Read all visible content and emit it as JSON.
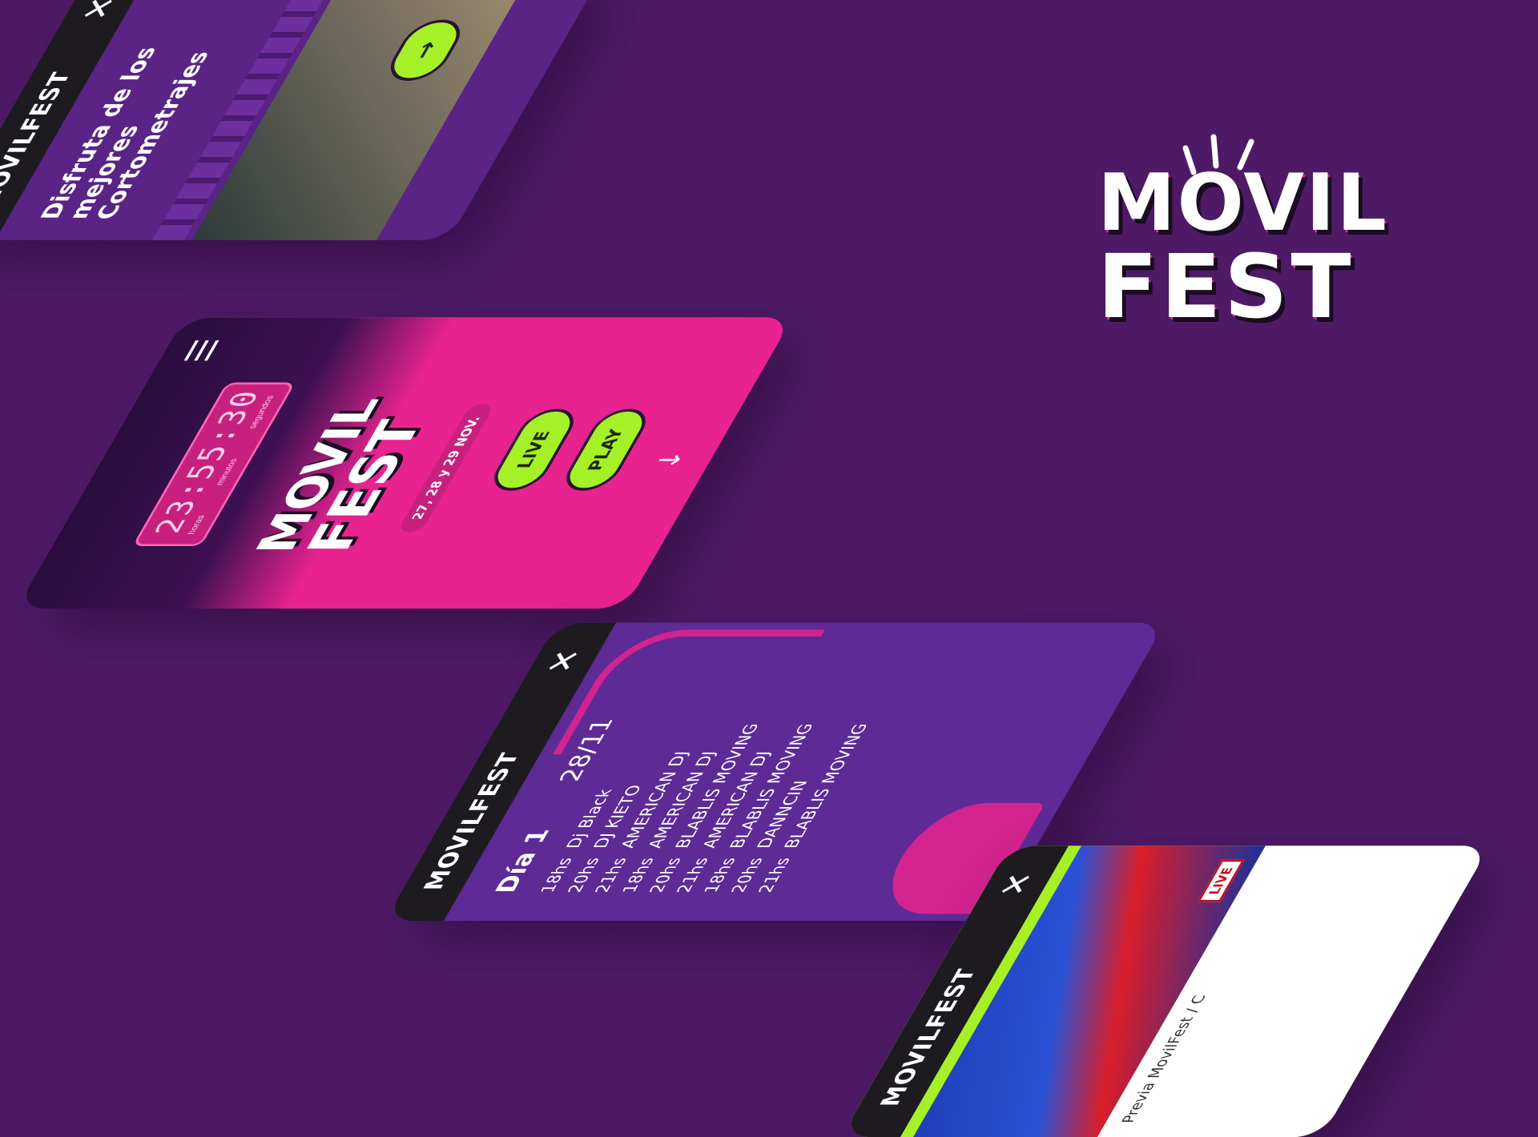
{
  "brand": {
    "logo_line1": "MOVIL",
    "logo_line2": "FEST",
    "navbar_logo": "MOVILFEST"
  },
  "colors": {
    "background": "#4e1a66",
    "accent_green": "#a6f028",
    "hot_pink": "#e8238f",
    "dark_bar": "#1d1b1f"
  },
  "screen_intro": {
    "heading_line1": "Disfruta de los",
    "heading_line2": "mejores",
    "heading_line3": "Cortometrajes",
    "close_label": "X",
    "play_icon": "arrow-right-icon"
  },
  "screen_home": {
    "countdown": "23:55:30",
    "countdown_labels": [
      "horas",
      "minutos",
      "segundos"
    ],
    "logo_line1": "MOVIL",
    "logo_line2": "FEST",
    "dates": "27, 28 y 29 NOV.",
    "live_button": "LIVE",
    "play_button": "PLAY",
    "scroll_icon": "arrow-down-icon",
    "menu_icon": "hamburger-icon"
  },
  "screen_schedule": {
    "close_label": "X",
    "day_title": "Día 1",
    "day_date": "28/11",
    "rows": [
      {
        "time": "18hs",
        "artist": "Dj Black"
      },
      {
        "time": "20hs",
        "artist": "DJ KIETO"
      },
      {
        "time": "21hs",
        "artist": "AMERICAN DJ"
      },
      {
        "time": "18hs",
        "artist": "AMERICAN DJ"
      },
      {
        "time": "20hs",
        "artist": "BLABLIS MOVING"
      },
      {
        "time": "21hs",
        "artist": "AMERICAN DJ"
      },
      {
        "time": "18hs",
        "artist": "BLABLIS MOVING"
      },
      {
        "time": "20hs",
        "artist": "DANNCIN"
      },
      {
        "time": "21hs",
        "artist": "BLABLIS MOVING"
      }
    ]
  },
  "screen_video": {
    "close_label": "X",
    "caption": "Previa MovilFest / C",
    "live_badge": "LIVE"
  }
}
